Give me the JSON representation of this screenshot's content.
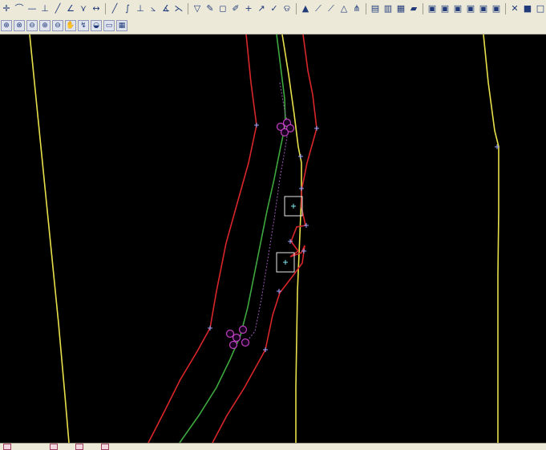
{
  "toolbar_top": {
    "groups": [
      [
        "snap-point-icon",
        "arc-icon",
        "line-h-icon",
        "perpendicular-icon",
        "slash-icon",
        "angle-icon",
        "tangent-icon",
        "dash-icon"
      ],
      [
        "line-icon",
        "curve-icon",
        "perpendicular-icon",
        "slope-icon",
        "angle-measure-icon",
        "vertex-icon"
      ],
      [
        "filter-icon",
        "pencil-icon",
        "box-icon",
        "brush-icon",
        "cross-icon",
        "line-arrow-icon",
        "check-icon",
        "spiral-icon"
      ],
      [
        "up-icon",
        "diag-icon",
        "diag2-icon",
        "triangle-icon",
        "fork-icon"
      ],
      [
        "profile-icon",
        "profile2-icon",
        "profile3-icon",
        "folder-icon"
      ],
      [
        "grid-icon",
        "grid2-icon",
        "grid3-icon",
        "grid4-icon",
        "grid5-icon",
        "grid6-icon"
      ],
      [
        "xml-icon",
        "blue-box-icon",
        "square-icon",
        "square2-icon",
        "image-icon",
        "diamond-icon"
      ]
    ]
  },
  "toolbar_view": {
    "items": [
      "zoom-window-icon",
      "zoom-extents-icon",
      "zoom-previous-icon",
      "zoom-in-icon",
      "zoom-out-icon",
      "pan-icon",
      "regen-icon",
      "layer-icon",
      "named-view-icon",
      "properties-icon"
    ]
  },
  "drawing": {
    "background_color": "#000000",
    "line_colors": {
      "edge_yellow": "#e8e04a",
      "boundary_red": "#d8262a",
      "centerline_green": "#3ea83e",
      "dashed_purple": "#9b59b6",
      "grip_magenta": "#c040c0",
      "vertex_cross": "#9aa6ff"
    }
  }
}
